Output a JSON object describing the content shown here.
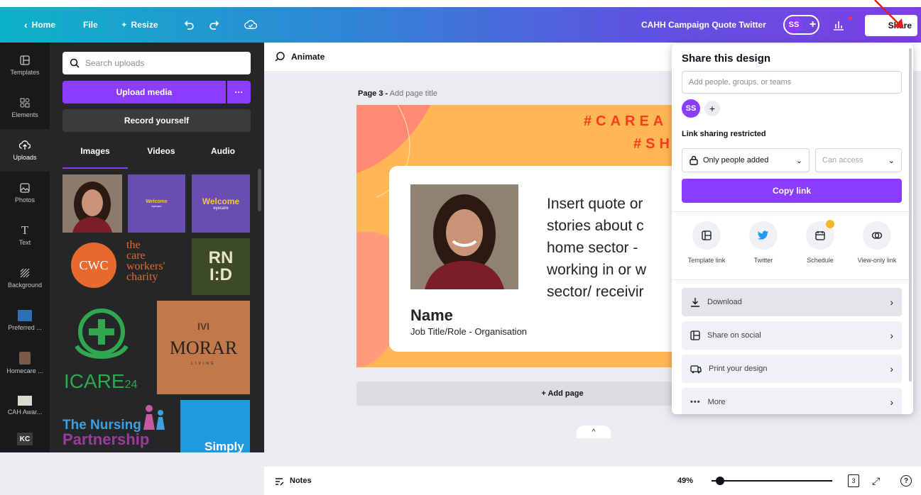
{
  "topbar": {
    "home_label": "Home",
    "file_label": "File",
    "resize_label": "Resize",
    "doc_title": "CAHH Campaign Quote Twitter",
    "avatar_initials": "SS",
    "share_label": "Share",
    "accent": "#8b3dff"
  },
  "sidebar": {
    "items": [
      {
        "label": "Templates",
        "icon": "templates-icon"
      },
      {
        "label": "Elements",
        "icon": "elements-icon"
      },
      {
        "label": "Uploads",
        "icon": "uploads-icon"
      },
      {
        "label": "Photos",
        "icon": "photos-icon"
      },
      {
        "label": "Text",
        "icon": "text-icon"
      },
      {
        "label": "Background",
        "icon": "background-icon"
      },
      {
        "label": "Preferred ...",
        "icon": "folder-thumb"
      },
      {
        "label": "Homecare ...",
        "icon": "folder-thumb"
      },
      {
        "label": "CAH Awar...",
        "icon": "folder-thumb"
      },
      {
        "label": "KC",
        "icon": "folder-thumb"
      }
    ]
  },
  "uploads": {
    "search_placeholder": "Search uploads",
    "upload_label": "Upload media",
    "more_label": "···",
    "record_label": "Record yourself",
    "tabs": [
      "Images",
      "Videos",
      "Audio"
    ],
    "thumbs": {
      "welcome1_title": "Welcome",
      "welcome1_sub": "eyecare",
      "welcome2_title": "Welcome",
      "welcome2_sub": "eyecare",
      "cwc_text": "CWC",
      "cwc_words": [
        "the",
        "care",
        "workers'",
        "charity"
      ],
      "rnid_line1": "RN",
      "rnid_line2": "I:D",
      "icare_text": "ICARE",
      "icare_num": "24",
      "morar_mark": "IVI",
      "morar_text": "MORAR",
      "morar_sub": "LIVING",
      "nursing_line1": "The Nursing",
      "nursing_line2": "Partnership",
      "simply_text": "Simply"
    }
  },
  "canvas": {
    "animate_label": "Animate",
    "page_label": "Page 3 -",
    "page_title_placeholder": "Add page title",
    "hashtag_line1": "#CAREA",
    "hashtag_line2": "#SH",
    "quote_lines": [
      "Insert quote or",
      "stories about c",
      "home sector -",
      "working in or w",
      "sector/ receivir"
    ],
    "name": "Name",
    "job_title": "Job Title/Role - Organisation",
    "add_page_label": "+ Add page",
    "design_bg": "#ffb655",
    "hashtag_color": "#ff3b1f"
  },
  "bottombar": {
    "notes_label": "Notes",
    "zoom_label": "49%",
    "zoom_fraction": 0.07,
    "page_count": "3"
  },
  "share_panel": {
    "title": "Share this design",
    "people_placeholder": "Add people, groups, or teams",
    "avatar_initials": "SS",
    "link_label": "Link sharing restricted",
    "access_option": "Only people added",
    "permission_option": "Can access",
    "copy_label": "Copy link",
    "quick_actions": [
      {
        "label": "Template link",
        "icon": "template-link-icon"
      },
      {
        "label": "Twitter",
        "icon": "twitter-icon"
      },
      {
        "label": "Schedule",
        "icon": "schedule-icon"
      },
      {
        "label": "View-only link",
        "icon": "view-only-link-icon"
      }
    ],
    "rows": [
      {
        "label": "Download",
        "icon": "download-icon"
      },
      {
        "label": "Share on social",
        "icon": "share-social-icon"
      },
      {
        "label": "Print your design",
        "icon": "print-icon"
      },
      {
        "label": "More",
        "icon": "more-icon"
      }
    ]
  }
}
